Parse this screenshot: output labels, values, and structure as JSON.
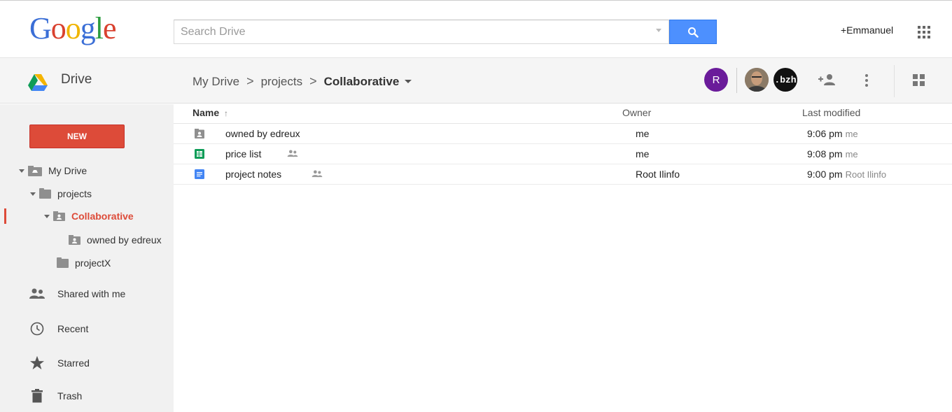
{
  "header": {
    "logo_letters": [
      {
        "ch": "G",
        "color": "#3a6ed6"
      },
      {
        "ch": "o",
        "color": "#d9412f"
      },
      {
        "ch": "o",
        "color": "#f0b400"
      },
      {
        "ch": "g",
        "color": "#3a6ed6"
      },
      {
        "ch": "l",
        "color": "#2c9c3f"
      },
      {
        "ch": "e",
        "color": "#d9412f"
      }
    ],
    "search_placeholder": "Search Drive",
    "search_button_icon": "search-icon",
    "user_link": "+Emmanuel",
    "apps_icon": "apps-grid-icon"
  },
  "toolbar": {
    "app_name": "Drive",
    "breadcrumb": [
      "My Drive",
      "projects",
      "Collaborative"
    ],
    "breadcrumb_separator": ">",
    "collaborators": [
      "R",
      ".bzh"
    ],
    "icons": [
      "add-person-icon",
      "more-vert-icon",
      "grid-view-icon"
    ]
  },
  "sidebar": {
    "new_label": "NEW",
    "tree": [
      {
        "label": "My Drive",
        "expanded": true
      },
      {
        "label": "projects",
        "expanded": true
      },
      {
        "label": "Collaborative",
        "expanded": true,
        "selected": true
      },
      {
        "label": "owned by edreux"
      },
      {
        "label": "projectX"
      }
    ],
    "nav": [
      {
        "label": "Shared with me",
        "icon": "people-icon"
      },
      {
        "label": "Recent",
        "icon": "clock-icon"
      },
      {
        "label": "Starred",
        "icon": "star-icon"
      },
      {
        "label": "Trash",
        "icon": "trash-icon"
      }
    ]
  },
  "list": {
    "columns": {
      "name": "Name",
      "sort_arrow": "↑",
      "owner": "Owner",
      "modified": "Last modified"
    },
    "rows": [
      {
        "name": "owned by edreux",
        "type": "shared-folder",
        "shared": false,
        "owner": "me",
        "time": "9:06 pm",
        "by": "me"
      },
      {
        "name": "price list",
        "type": "spreadsheet",
        "shared": true,
        "owner": "me",
        "time": "9:08 pm",
        "by": "me"
      },
      {
        "name": "project notes",
        "type": "document",
        "shared": true,
        "owner": "Root Ilinfo",
        "time": "9:00 pm",
        "by": "Root Ilinfo"
      }
    ]
  },
  "colors": {
    "accent_red": "#dd4b39",
    "search_blue": "#4d90fe",
    "sheets_green": "#0f9d58",
    "docs_blue": "#4285f4",
    "avatar_purple": "#6a1b9a"
  }
}
